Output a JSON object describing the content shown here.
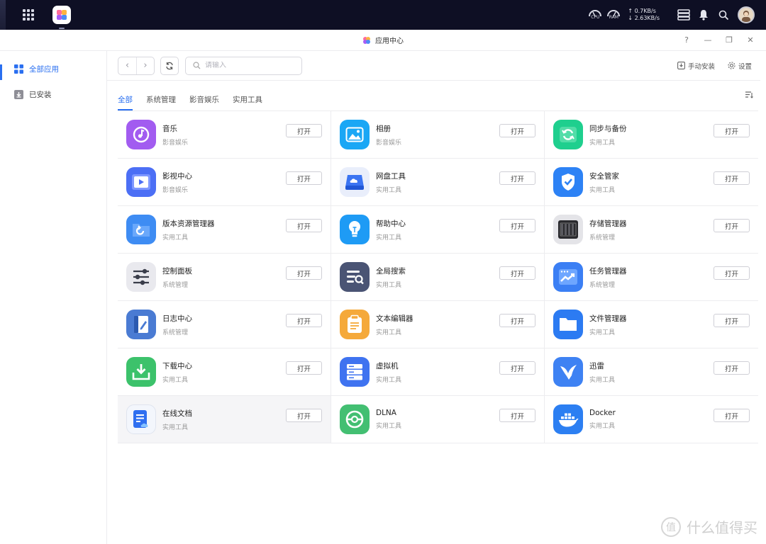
{
  "system_bar": {
    "cpu_label": "CPU",
    "ram_label": "RAM",
    "upload": "↑ 0.7KB/s",
    "download": "↓ 2.63KB/s"
  },
  "window": {
    "title": "应用中心",
    "help": "?",
    "minimize": "—",
    "restore": "❐",
    "close": "✕"
  },
  "sidebar": {
    "items": [
      {
        "label": "全部应用",
        "icon": "grid-icon",
        "active": true
      },
      {
        "label": "已安装",
        "icon": "download-box-icon",
        "active": false
      }
    ]
  },
  "toolbar": {
    "back": "‹",
    "forward": "›",
    "search_placeholder": "请输入",
    "manual_install": "手动安装",
    "settings": "设置"
  },
  "tabs": [
    {
      "label": "全部",
      "active": true
    },
    {
      "label": "系统管理",
      "active": false
    },
    {
      "label": "影音娱乐",
      "active": false
    },
    {
      "label": "实用工具",
      "active": false
    }
  ],
  "open_label": "打开",
  "apps": [
    {
      "name": "音乐",
      "category": "影音娱乐",
      "icon": "music-icon",
      "color": "#a25cf0"
    },
    {
      "name": "相册",
      "category": "影音娱乐",
      "icon": "photo-icon",
      "color": "#1aa7f5"
    },
    {
      "name": "同步与备份",
      "category": "实用工具",
      "icon": "sync-icon",
      "color": "#1fcf8e"
    },
    {
      "name": "影视中心",
      "category": "影音娱乐",
      "icon": "video-icon",
      "color": "#4c6ff5"
    },
    {
      "name": "网盘工具",
      "category": "实用工具",
      "icon": "cloud-drive-icon",
      "color": "#e9eefb"
    },
    {
      "name": "安全管家",
      "category": "实用工具",
      "icon": "shield-icon",
      "color": "#2d82f5"
    },
    {
      "name": "版本资源管理器",
      "category": "实用工具",
      "icon": "folder-restore-icon",
      "color": "#3e8cf3"
    },
    {
      "name": "帮助中心",
      "category": "实用工具",
      "icon": "bulb-icon",
      "color": "#1e9bf5"
    },
    {
      "name": "存储管理器",
      "category": "系统管理",
      "icon": "storage-icon",
      "color": "#e4e4e8"
    },
    {
      "name": "控制面板",
      "category": "系统管理",
      "icon": "sliders-icon",
      "color": "#e9e9ee"
    },
    {
      "name": "全局搜索",
      "category": "实用工具",
      "icon": "global-search-icon",
      "color": "#4a5474"
    },
    {
      "name": "任务管理器",
      "category": "系统管理",
      "icon": "task-manager-icon",
      "color": "#3b7ff4"
    },
    {
      "name": "日志中心",
      "category": "系统管理",
      "icon": "log-book-icon",
      "color": "#4a7bd3"
    },
    {
      "name": "文本编辑器",
      "category": "实用工具",
      "icon": "notepad-icon",
      "color": "#f5a93a"
    },
    {
      "name": "文件管理器",
      "category": "实用工具",
      "icon": "folder-icon",
      "color": "#2c7bf2"
    },
    {
      "name": "下载中心",
      "category": "实用工具",
      "icon": "download-icon",
      "color": "#3cc26b"
    },
    {
      "name": "虚拟机",
      "category": "实用工具",
      "icon": "server-icon",
      "color": "#3f73f0"
    },
    {
      "name": "迅雷",
      "category": "实用工具",
      "icon": "thunder-bird-icon",
      "color": "#3e82f3"
    },
    {
      "name": "在线文档",
      "category": "实用工具",
      "icon": "online-doc-icon",
      "color": "#f3f6fc"
    },
    {
      "name": "DLNA",
      "category": "实用工具",
      "icon": "dlna-icon",
      "color": "#43bf72"
    },
    {
      "name": "Docker",
      "category": "实用工具",
      "icon": "docker-whale-icon",
      "color": "#2c7ff2"
    }
  ],
  "watermark": {
    "glyph": "值",
    "text": "什么值得买"
  }
}
